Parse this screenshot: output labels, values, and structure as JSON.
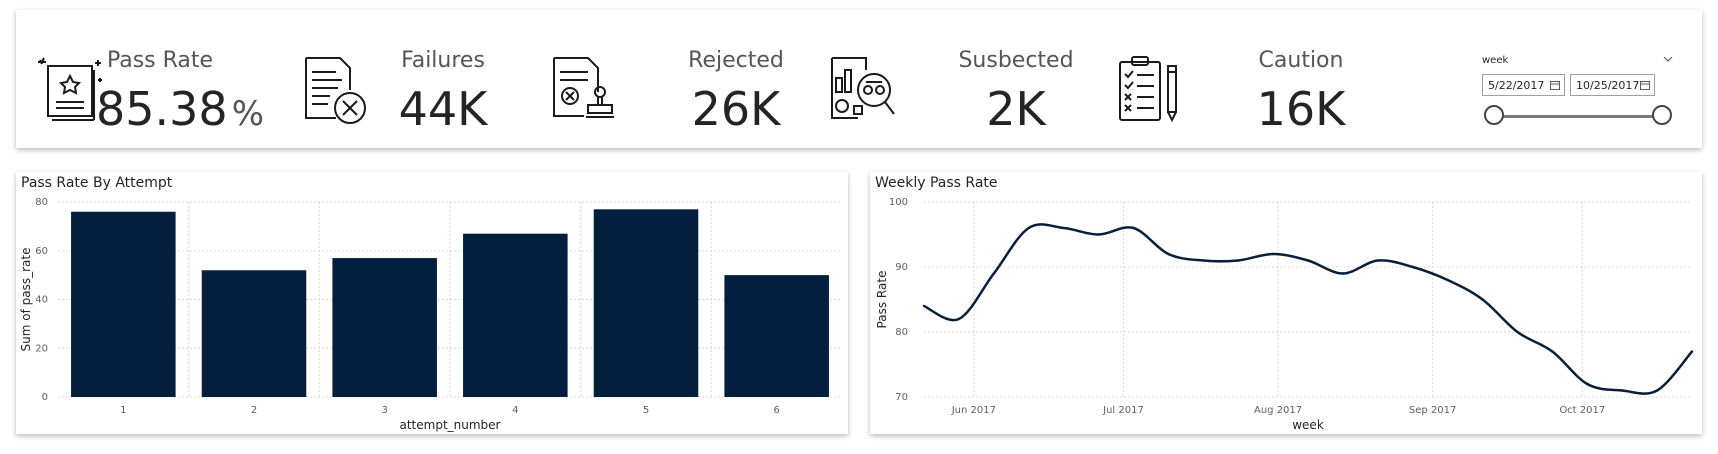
{
  "kpis": [
    {
      "title": "Pass Rate",
      "value": "85.38",
      "unit": "%",
      "icon": "certificate-icon"
    },
    {
      "title": "Failures",
      "value": "44K",
      "icon": "document-x-icon"
    },
    {
      "title": "Rejected",
      "value": "26K",
      "icon": "stamped-document-icon"
    },
    {
      "title": "Susbected",
      "value": "2K",
      "icon": "report-inspect-icon"
    },
    {
      "title": "Caution",
      "value": "16K",
      "icon": "checklist-icon"
    }
  ],
  "slicer": {
    "label": "week",
    "start_date": "5/22/2017",
    "end_date": "10/25/2017",
    "range_selected": [
      0,
      1
    ]
  },
  "bar_chart": {
    "title": "Pass Rate By Attempt"
  },
  "line_chart": {
    "title": "Weekly Pass Rate"
  },
  "colors": {
    "bar": "#041E3D",
    "line": "#0A1E3A",
    "grid": "#D9D9D9"
  },
  "chart_data": [
    {
      "type": "bar",
      "title": "Pass Rate By Attempt",
      "xlabel": "attempt_number",
      "ylabel": "Sum of pass_rate",
      "categories": [
        "1",
        "2",
        "3",
        "4",
        "5",
        "6"
      ],
      "values": [
        76,
        52,
        57,
        67,
        77,
        50
      ],
      "ylim": [
        0,
        80
      ],
      "yticks": [
        0,
        20,
        40,
        60,
        80
      ],
      "grid": true
    },
    {
      "type": "line",
      "title": "Weekly Pass Rate",
      "xlabel": "week",
      "ylabel": "Pass Rate",
      "x": [
        "2017-05-22",
        "2017-05-29",
        "2017-06-05",
        "2017-06-12",
        "2017-06-19",
        "2017-06-26",
        "2017-07-03",
        "2017-07-10",
        "2017-07-17",
        "2017-07-24",
        "2017-07-31",
        "2017-08-07",
        "2017-08-14",
        "2017-08-21",
        "2017-08-28",
        "2017-09-04",
        "2017-09-11",
        "2017-09-18",
        "2017-09-25",
        "2017-10-02",
        "2017-10-09",
        "2017-10-16",
        "2017-10-23"
      ],
      "y": [
        84,
        82,
        89,
        96,
        96,
        95,
        96,
        92,
        91,
        91,
        92,
        91,
        89,
        91,
        90,
        88,
        85,
        80,
        77,
        72,
        71,
        71,
        77
      ],
      "xticks": [
        "Jun 2017",
        "Jul 2017",
        "Aug 2017",
        "Sep 2017",
        "Oct 2017"
      ],
      "xtick_dates": [
        "2017-06-01",
        "2017-07-01",
        "2017-08-01",
        "2017-09-01",
        "2017-10-01"
      ],
      "ylim": [
        70,
        100
      ],
      "yticks": [
        70,
        80,
        90,
        100
      ],
      "grid": true
    }
  ]
}
